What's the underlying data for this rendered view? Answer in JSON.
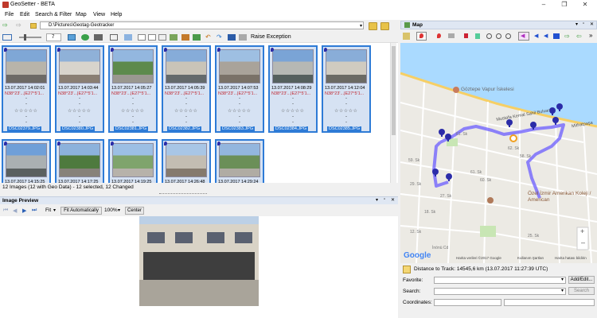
{
  "window": {
    "title": "GeoSetter - BETA",
    "minimize": "–",
    "maximize": "❐",
    "close": "✕"
  },
  "menu": [
    "File",
    "Edit",
    "Search & Filter",
    "Map",
    "View",
    "Help"
  ],
  "path": {
    "value": "D:\\Pictures\\Geotag-Geotracker"
  },
  "toolbar": {
    "zoom_value": "7",
    "raise_exception": "Raise Exception"
  },
  "thumbnails": [
    {
      "date": "13.07.2017 14:02:01",
      "geo": "N38°23'...|E27°5'1...",
      "name": "DSC02379.JPG",
      "colors": [
        "#7fa7d6",
        "#b8b4aa",
        "#6d6a66"
      ]
    },
    {
      "date": "13.07.2017 14:03:44",
      "geo": "N38°23'...|E27°5'1...",
      "name": "DSC02380.JPG",
      "colors": [
        "#8fb1d8",
        "#d8d4cc",
        "#8a7f74"
      ]
    },
    {
      "date": "13.07.2017 14:05:27",
      "geo": "N38°23'...|E27°5'1...",
      "name": "DSC02381.JPG",
      "colors": [
        "#93b7df",
        "#5d8a4c",
        "#9a9890"
      ]
    },
    {
      "date": "13.07.2017 14:05:39",
      "geo": "N38°23'...|E27°5'1...",
      "name": "DSC02382.JPG",
      "colors": [
        "#86acd9",
        "#c9c4b8",
        "#646a6c"
      ]
    },
    {
      "date": "13.07.2017 14:07:53",
      "geo": "N38°23'...|E27°5'1...",
      "name": "DSC02383.JPG",
      "colors": [
        "#9ebfe2",
        "#a9a39a",
        "#7a7268"
      ]
    },
    {
      "date": "13.07.2017 14:08:29",
      "geo": "N38°23'...|E27°5'1...",
      "name": "DSC02384.JPG",
      "colors": [
        "#7aa4d6",
        "#b6b8b4",
        "#55605e"
      ]
    },
    {
      "date": "13.07.2017 14:12:04",
      "geo": "N38°23'...|E27°5'1...",
      "name": "DSC02385.JPG",
      "colors": [
        "#89add8",
        "#d0cbc0",
        "#6b6a64"
      ]
    },
    {
      "date": "13.07.2017 14:15:25",
      "geo": "",
      "name": "",
      "colors": [
        "#6f9fd8",
        "#aab0b2",
        "#5a6060"
      ]
    },
    {
      "date": "13.07.2017 14:17:25",
      "geo": "",
      "name": "",
      "colors": [
        "#8cb2dc",
        "#4e7a3e",
        "#87827a"
      ]
    },
    {
      "date": "13.07.2017 14:19:25",
      "geo": "",
      "name": "",
      "colors": [
        "#9cbfe4",
        "#7fa46c",
        "#b7b2aa"
      ]
    },
    {
      "date": "13.07.2017 14:26:48",
      "geo": "",
      "name": "",
      "colors": [
        "#a8c6e6",
        "#c3bdb2",
        "#857a6e"
      ]
    },
    {
      "date": "13.07.2017 14:29:24",
      "geo": "",
      "name": "",
      "colors": [
        "#93b6de",
        "#6b8f58",
        "#b0aca4"
      ]
    }
  ],
  "status": "12 Images (12 with Geo Data) - 12 selected, 12 Changed",
  "preview": {
    "title": "Image Preview",
    "fit": "Fit",
    "fit_auto": "Fit Automatically",
    "zoom": "100%",
    "center": "Center"
  },
  "map": {
    "title": "Map",
    "label_ferry": "Göztepe Vapur İskelesi",
    "label_street1": "Mustafa Kemal Sahil Bulvarı",
    "label_street2": "Mithatpaşa",
    "label_school": "Özel İzmir Amerikan Koleji / American",
    "streets": [
      "59. Sk",
      "61. Sk",
      "62. Sk",
      "29. Sk",
      "27. Sk",
      "61. Sk",
      "60. Sk",
      "58. Sk",
      "18. Sk",
      "12. Sk",
      "25. Sk",
      "İnönü Cd"
    ],
    "copyright": "Harita verileri ©2017 Google",
    "terms": "Kullanım Şartları",
    "report": "Harita hatası bildirin",
    "google": "Google",
    "zoom_in": "+",
    "zoom_out": "–"
  },
  "distance": "Distance to Track: 14545,6 km (13.07.2017 11:27:39 UTC)",
  "favorite": {
    "label": "Favorite:",
    "button": "Add/Edit..."
  },
  "search": {
    "label": "Search:",
    "button": "Search"
  },
  "coordinates": {
    "label": "Coordinates:"
  }
}
